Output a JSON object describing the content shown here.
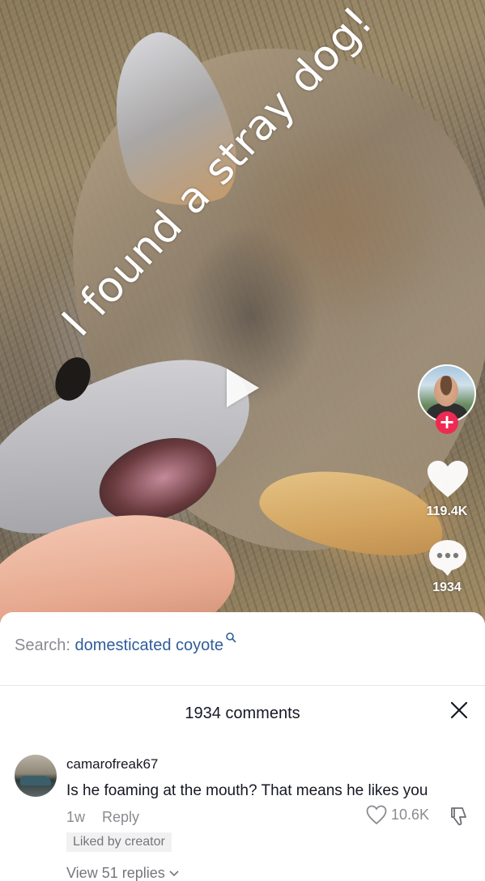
{
  "video": {
    "overlay_caption": "I found a stray dog!",
    "like_count": "119.4K",
    "comment_count": "1934",
    "icons": [
      "play-icon",
      "heart-icon",
      "comment-bubble-icon",
      "plus-icon"
    ]
  },
  "search": {
    "label": "Search:",
    "query": "domesticated coyote"
  },
  "comments_panel": {
    "title": "1934 comments",
    "close_icon": "close-icon"
  },
  "comments": [
    {
      "username": "camarofreak67",
      "text": "Is he foaming at the mouth? That means he likes you",
      "time": "1w",
      "reply_label": "Reply",
      "like_count": "10.6K",
      "liked_by_creator_label": "Liked by creator",
      "view_replies_label": "View 51 replies"
    }
  ],
  "colors": {
    "follow_accent": "#ee2a53",
    "search_link": "#2f5d9a",
    "muted_text": "#8a8b91",
    "primary_text": "#161823"
  }
}
